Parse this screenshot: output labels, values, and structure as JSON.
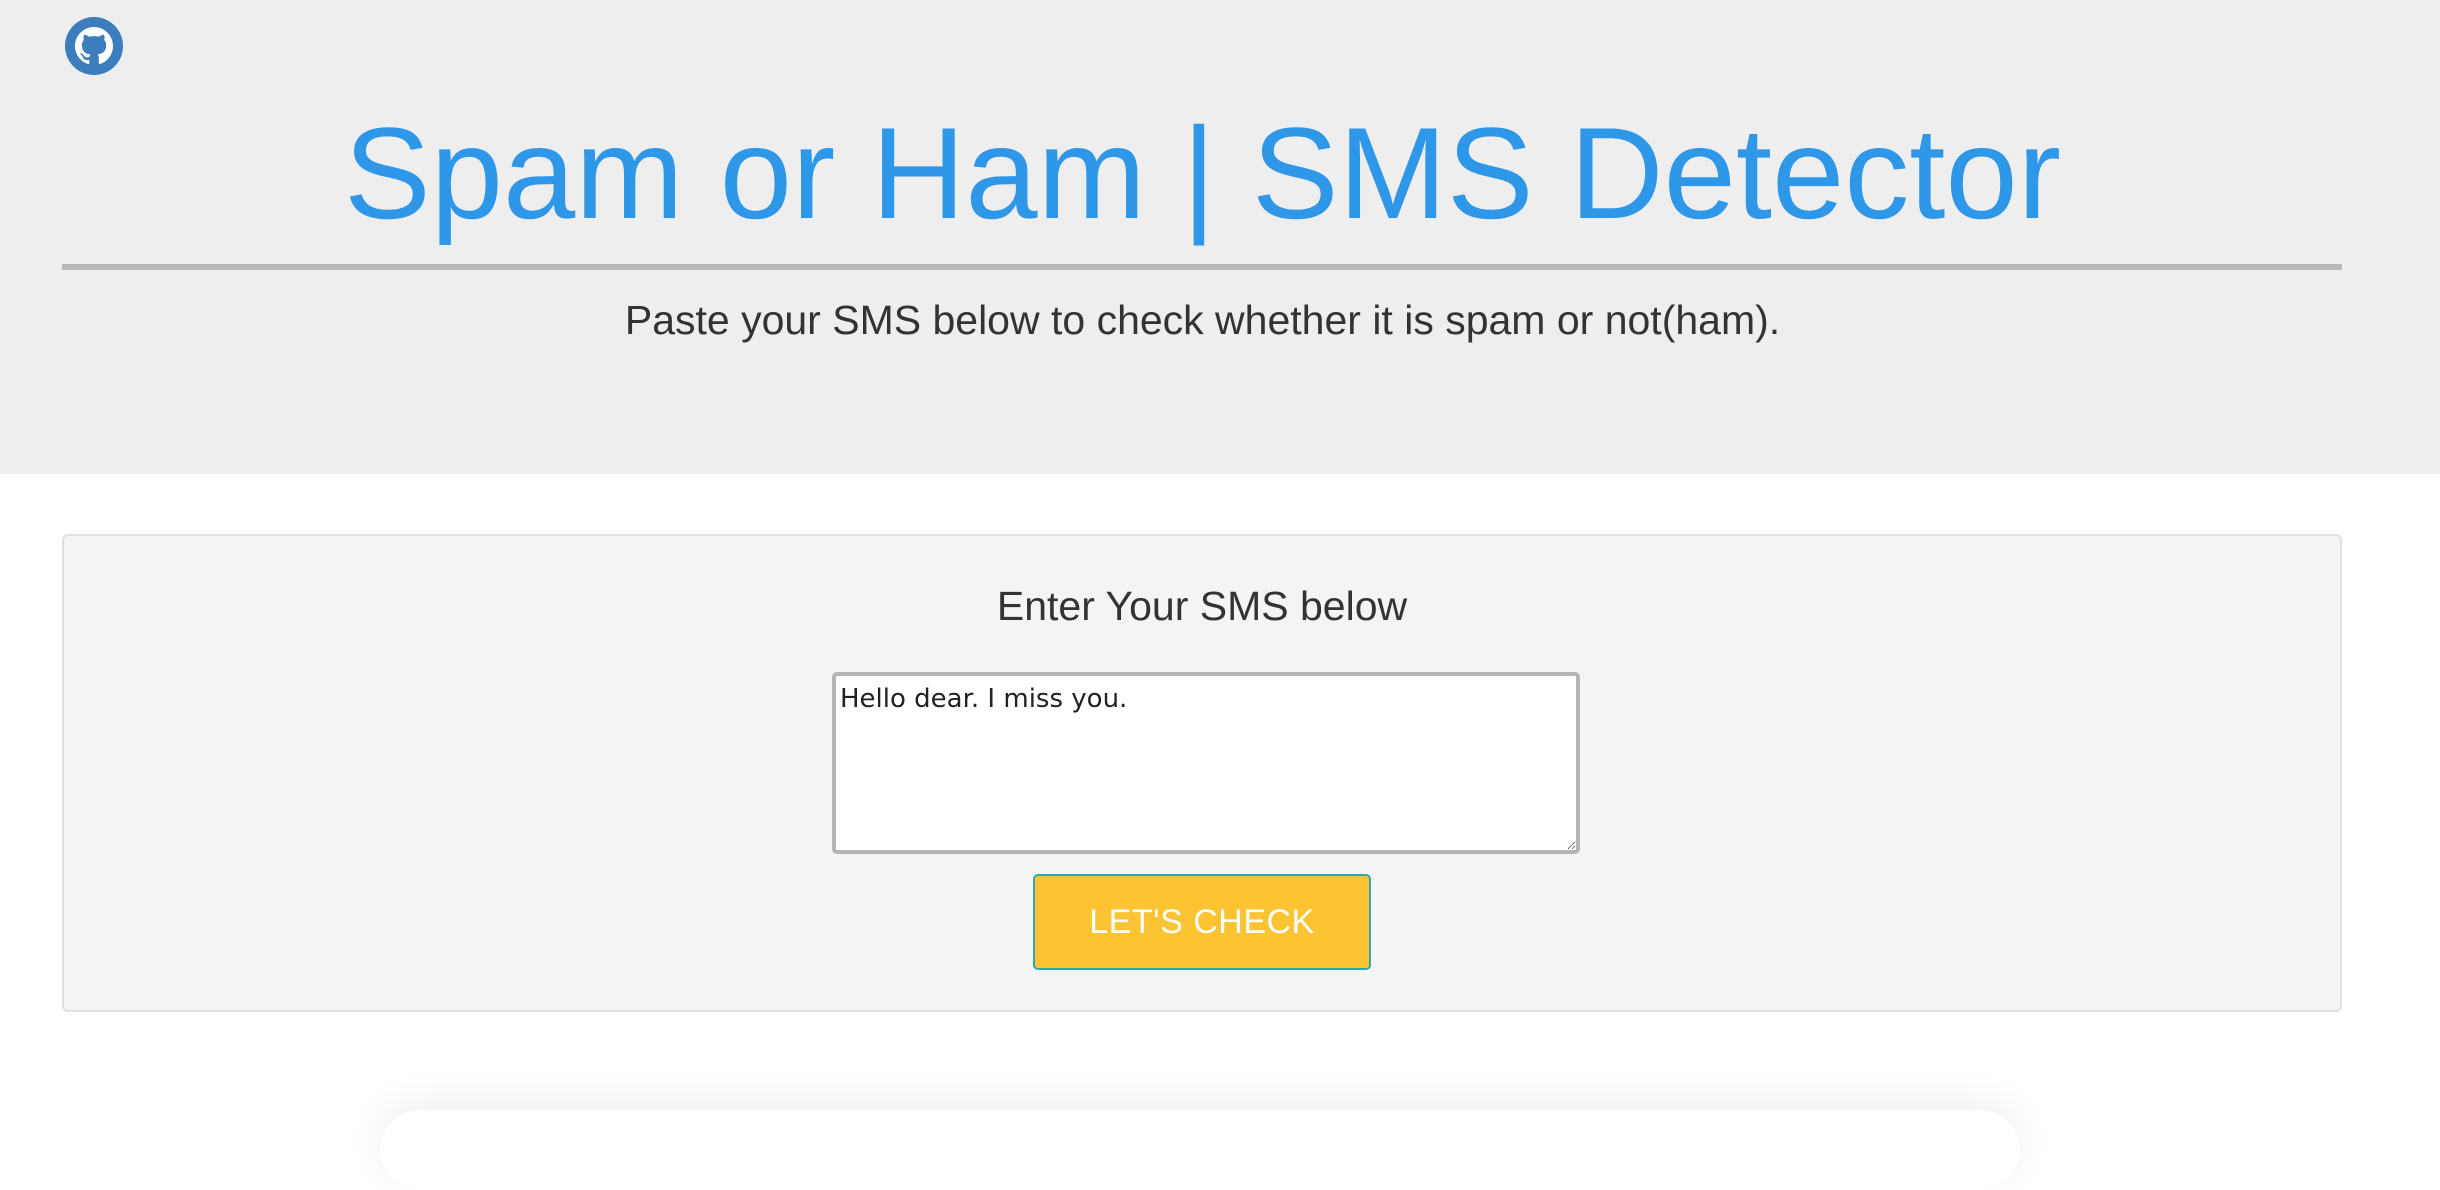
{
  "header": {
    "github_icon": "github-icon",
    "title": "Spam or Ham | SMS Detector",
    "subtitle": "Paste your SMS below to check whether it is spam or not(ham)."
  },
  "form": {
    "heading": "Enter Your SMS below",
    "sms_value": "Hello dear. I miss you.",
    "submit_label": "LET'S CHECK"
  },
  "colors": {
    "title": "#2e97e8",
    "hero_background": "#eeeeee",
    "panel_background": "#f4f4f4",
    "button_background": "#fcc433",
    "button_border": "#2fa9a8",
    "github_icon": "#3b7dbd"
  }
}
